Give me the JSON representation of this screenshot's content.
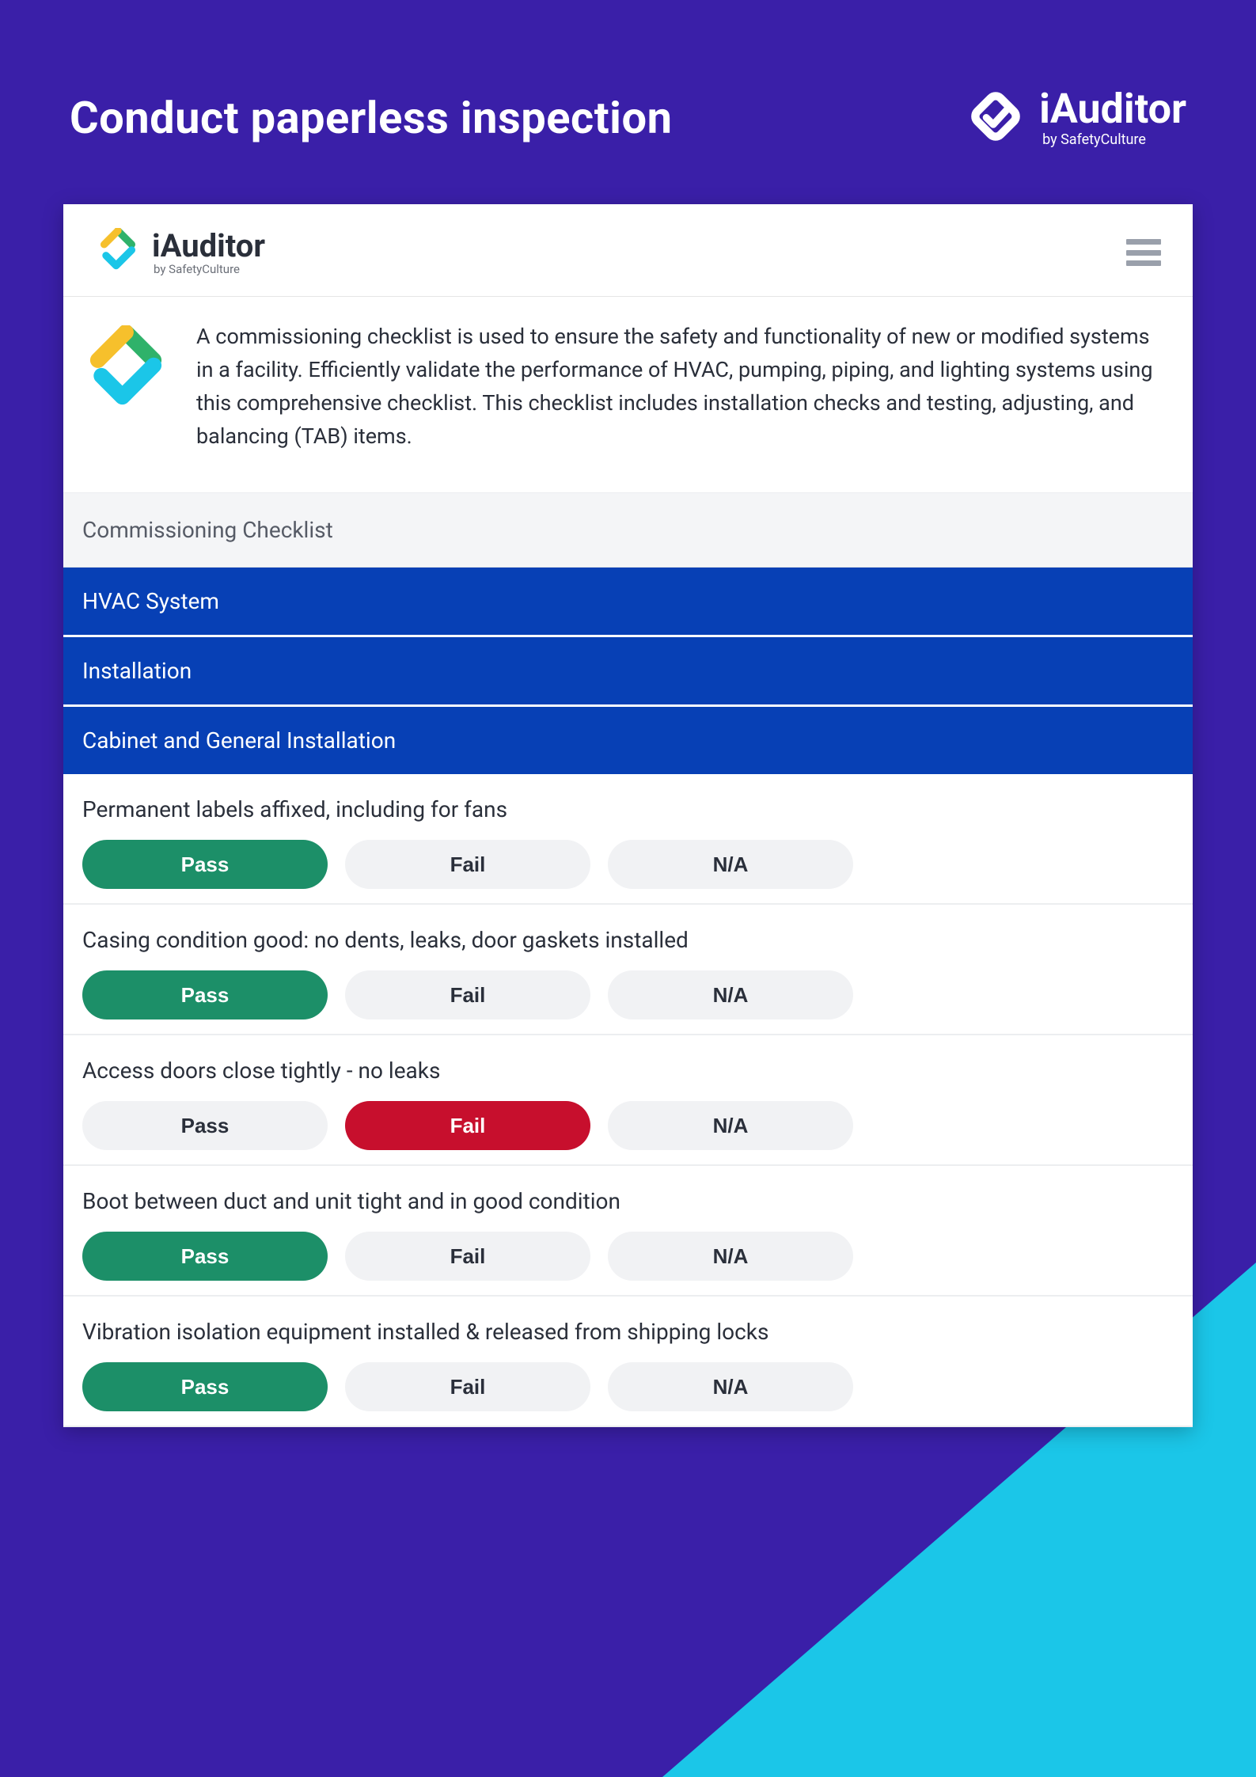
{
  "header": {
    "title": "Conduct paperless inspection",
    "brand_name": "iAuditor",
    "brand_sub": "by SafetyCulture"
  },
  "topbar": {
    "app_name": "iAuditor",
    "app_sub": "by SafetyCulture"
  },
  "description": "A commissioning checklist is used to ensure the safety and functionality of new or modified systems in a facility. Efficiently validate the performance of HVAC, pumping, piping, and lighting systems using this comprehensive checklist. This checklist includes installation checks and testing, adjusting, and balancing (TAB) items.",
  "sections": {
    "grey": "Commissioning Checklist",
    "blue1": "HVAC System",
    "blue2": "Installation",
    "blue3": "Cabinet and General Installation"
  },
  "options": {
    "pass": "Pass",
    "fail": "Fail",
    "na": "N/A"
  },
  "questions": [
    {
      "text": "Permanent labels affixed, including for fans",
      "selected": "pass"
    },
    {
      "text": "Casing condition good: no dents, leaks, door gaskets installed",
      "selected": "pass"
    },
    {
      "text": "Access doors close tightly - no leaks",
      "selected": "fail"
    },
    {
      "text": "Boot between duct and unit tight and in good condition",
      "selected": "pass"
    },
    {
      "text": "Vibration isolation equipment installed & released from shipping locks",
      "selected": "pass"
    }
  ]
}
